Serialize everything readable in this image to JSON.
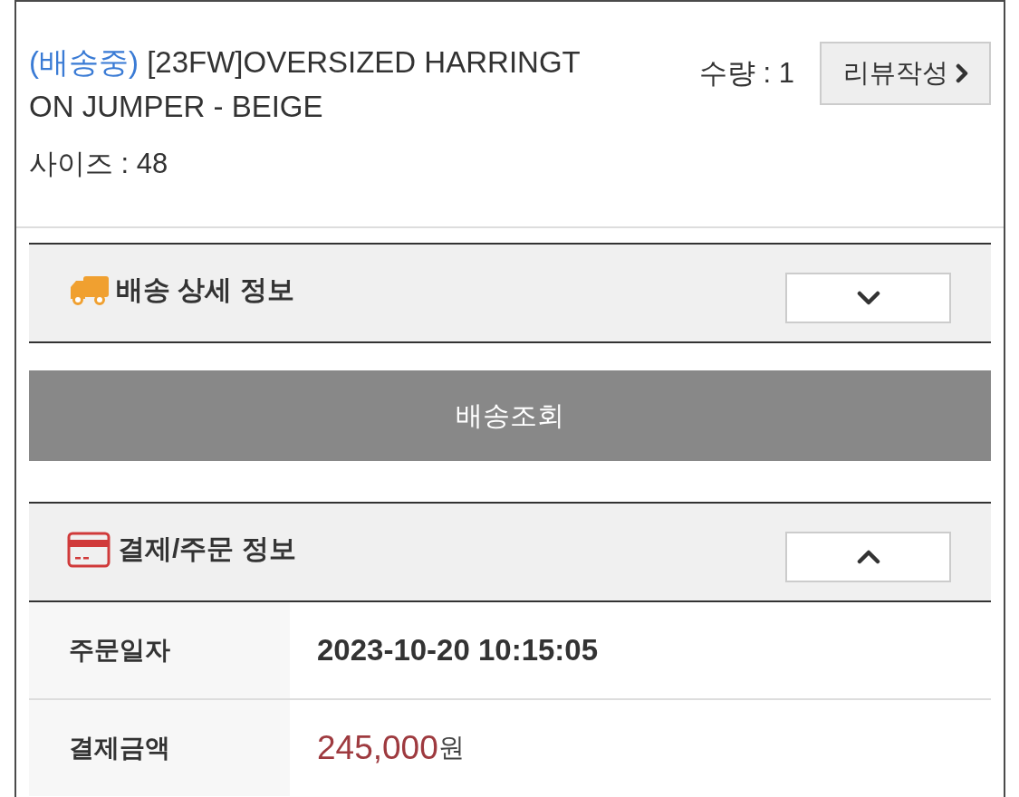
{
  "order_item": {
    "status": "(배송중)",
    "name": "[23FW]OVERSIZED HARRINGTON JUMPER - BEIGE",
    "option": "사이즈 : 48",
    "quantity": "수량 : 1",
    "review_button": "리뷰작성"
  },
  "shipping_section": {
    "title": "배송 상세 정보",
    "expanded": false
  },
  "track_button": "배송조회",
  "payment_section": {
    "title": "결제/주문 정보",
    "expanded": true,
    "rows": [
      {
        "kind": "date",
        "label": "주문일자",
        "value": "2023-10-20 10:15:05"
      },
      {
        "kind": "amount",
        "label": "결제금액",
        "value": "245,000",
        "unit": "원"
      }
    ]
  }
}
